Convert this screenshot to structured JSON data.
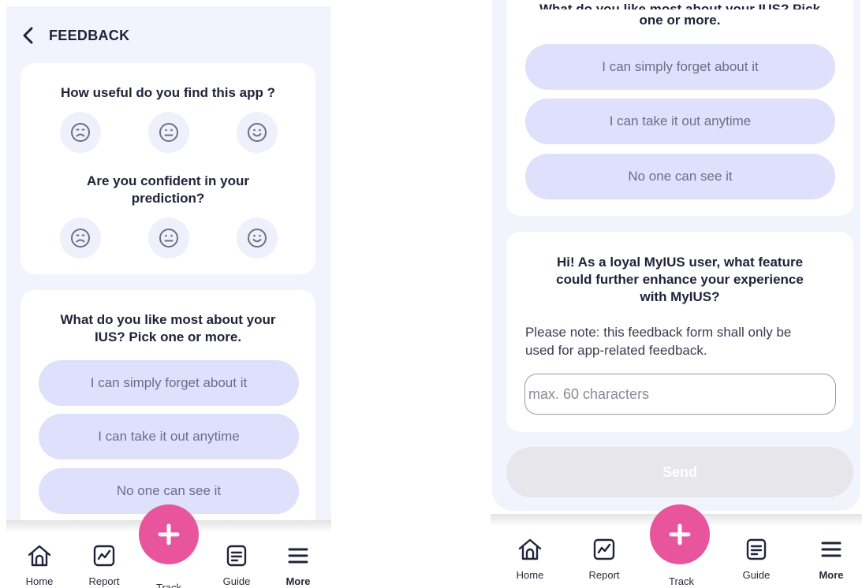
{
  "left_screen": {
    "header": {
      "back_icon": "chevron-left-icon",
      "title": "FEEDBACK"
    },
    "usefulness": {
      "question": "How useful do you find this app ?",
      "options": [
        "sad-face-icon",
        "neutral-face-icon",
        "happy-face-icon"
      ]
    },
    "confidence": {
      "question_line1": "Are you confident in your",
      "question_line2": "prediction?",
      "options": [
        "sad-face-icon",
        "neutral-face-icon",
        "happy-face-icon"
      ]
    },
    "likes": {
      "question_line1": "What do you like most about your",
      "question_line2": "IUS? Pick one or more.",
      "options": [
        "I can simply forget about it",
        "I can take it out anytime",
        "No one can see it"
      ]
    }
  },
  "right_screen": {
    "likes": {
      "question_partial": "What do you like most about your IUS? Pick",
      "question_line2": "one or more.",
      "options": [
        "I can simply forget about it",
        "I can take it out anytime",
        "No one can see it"
      ]
    },
    "feature": {
      "question_line1": "Hi! As a loyal MyIUS user, what feature",
      "question_line2": "could further enhance your experience",
      "question_line3": "with MyIUS?",
      "note_line1": "Please note: this feedback form shall only be",
      "note_line2": "used for app-related feedback.",
      "input_placeholder": "max. 60 characters",
      "input_value": ""
    },
    "send_label": "Send"
  },
  "bottom_nav": {
    "items": [
      {
        "label": "Home",
        "icon": "home-icon"
      },
      {
        "label": "Report",
        "icon": "chart-icon"
      },
      {
        "label": "Track",
        "icon": "plus-icon"
      },
      {
        "label": "Guide",
        "icon": "document-icon"
      },
      {
        "label": "More",
        "icon": "menu-icon",
        "active": true
      }
    ]
  },
  "colors": {
    "accent_pink": "#e8559c",
    "pill_background": "#dfe0fb",
    "screen_background": "#f2f4fd",
    "send_disabled": "#e7e6ea"
  }
}
